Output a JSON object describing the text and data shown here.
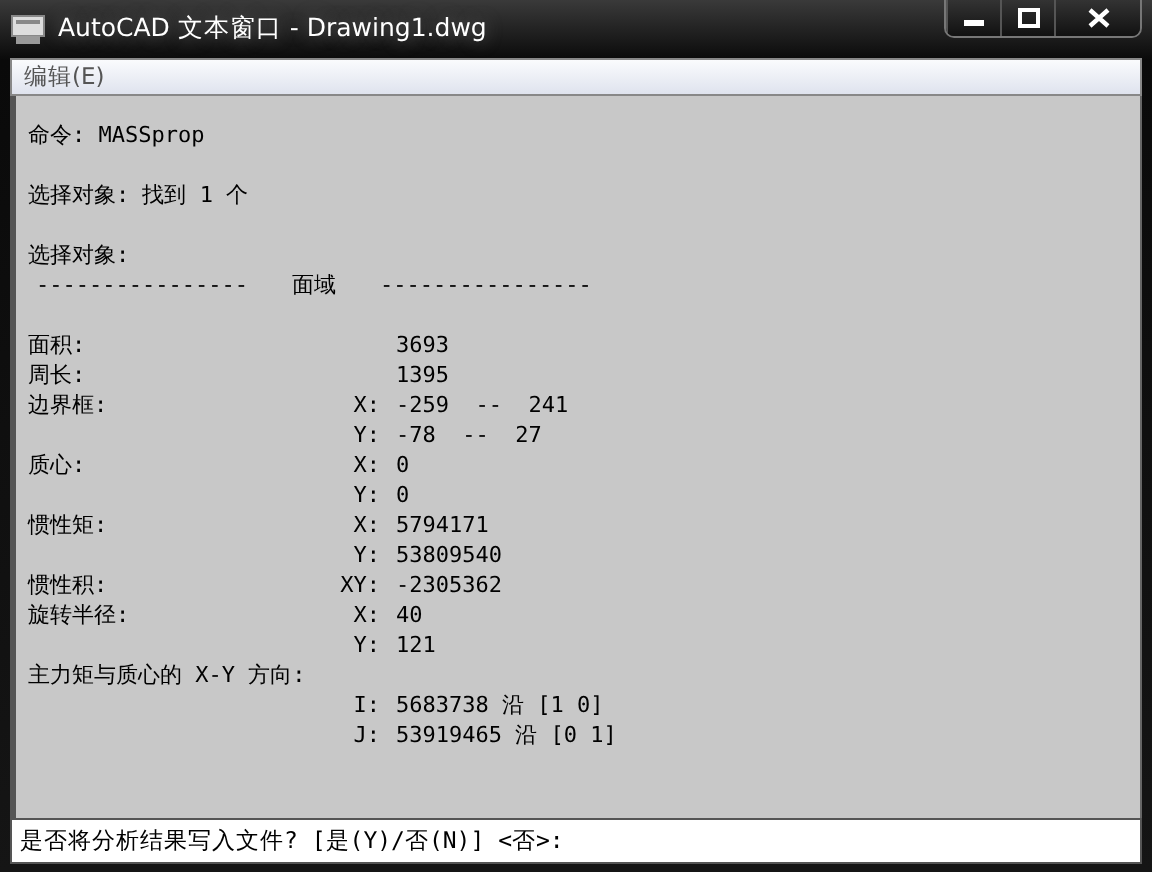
{
  "window": {
    "title": "AutoCAD 文本窗口 - Drawing1.dwg"
  },
  "menu": [
    "编辑(E)"
  ],
  "lines": [
    {
      "kind": "text",
      "text": "命令: MASSprop"
    },
    {
      "kind": "blank"
    },
    {
      "kind": "text",
      "text": "选择对象: 找到 1 个"
    },
    {
      "kind": "blank"
    },
    {
      "kind": "text",
      "text": "选择对象:"
    },
    {
      "kind": "header",
      "left": "----------------",
      "title": "面域",
      "right": "----------------"
    },
    {
      "kind": "blank"
    },
    {
      "kind": "prop",
      "label": "面积:",
      "value": "3693"
    },
    {
      "kind": "prop",
      "label": "周长:",
      "value": "1395"
    },
    {
      "kind": "prop",
      "label": "边界框:",
      "axis": "X:",
      "value": "-259  --  241"
    },
    {
      "kind": "prop",
      "axis": "Y:",
      "value": "-78  --  27"
    },
    {
      "kind": "prop",
      "label": "质心:",
      "axis": "X:",
      "value": "0"
    },
    {
      "kind": "prop",
      "axis": "Y:",
      "value": "0"
    },
    {
      "kind": "prop",
      "label": "惯性矩:",
      "axis": "X:",
      "value": "5794171"
    },
    {
      "kind": "prop",
      "axis": "Y:",
      "value": "53809540"
    },
    {
      "kind": "prop",
      "label": "惯性积:",
      "axis": "XY:",
      "value": "-2305362"
    },
    {
      "kind": "prop",
      "label": "旋转半径:",
      "axis": "X:",
      "value": "40"
    },
    {
      "kind": "prop",
      "axis": "Y:",
      "value": "121"
    },
    {
      "kind": "text",
      "text": "主力矩与质心的 X-Y 方向:"
    },
    {
      "kind": "prop",
      "axis": "I:",
      "value": "5683738 沿 [1 0]"
    },
    {
      "kind": "prop",
      "axis": "J:",
      "value": "53919465 沿 [0 1]"
    }
  ],
  "prompt": "是否将分析结果写入文件? [是(Y)/否(N)] <否>:"
}
